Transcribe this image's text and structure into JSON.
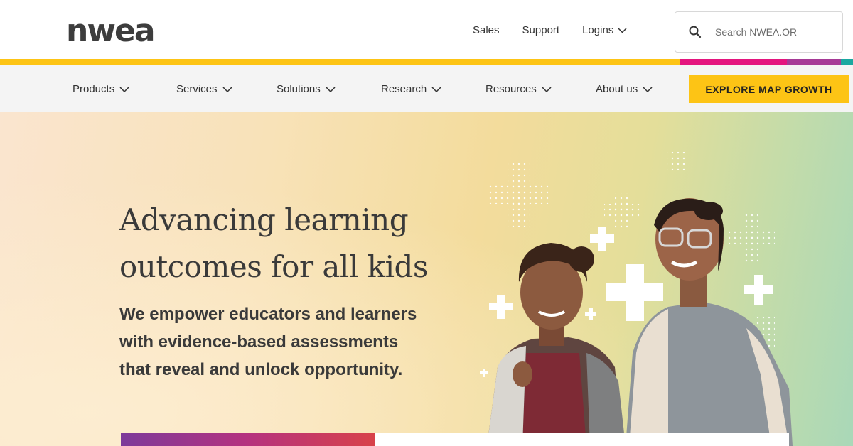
{
  "header": {
    "logo_text": "nwea",
    "utility_links": [
      {
        "label": "Sales"
      },
      {
        "label": "Support"
      },
      {
        "label": "Logins",
        "has_dropdown": true
      }
    ],
    "search": {
      "placeholder": "Search NWEA.OR"
    }
  },
  "accent_colors": [
    "#fdc415",
    "#e4157e",
    "#a63a96",
    "#1aa8a0"
  ],
  "nav": {
    "items": [
      {
        "label": "Products"
      },
      {
        "label": "Services"
      },
      {
        "label": "Solutions"
      },
      {
        "label": "Research"
      },
      {
        "label": "Resources"
      },
      {
        "label": "About us"
      }
    ],
    "cta_label": "EXPLORE MAP GROWTH"
  },
  "hero": {
    "headline_line1": "Advancing learning",
    "headline_line2": "outcomes for all kids",
    "subhead_line1": "We empower educators and learners",
    "subhead_line2": "with evidence-based assessments",
    "subhead_line3": "that reveal and unlock opportunity."
  },
  "colors": {
    "cta": "#fdc415",
    "text": "#3a3a3a",
    "nav_bg": "#f4f4f4"
  }
}
